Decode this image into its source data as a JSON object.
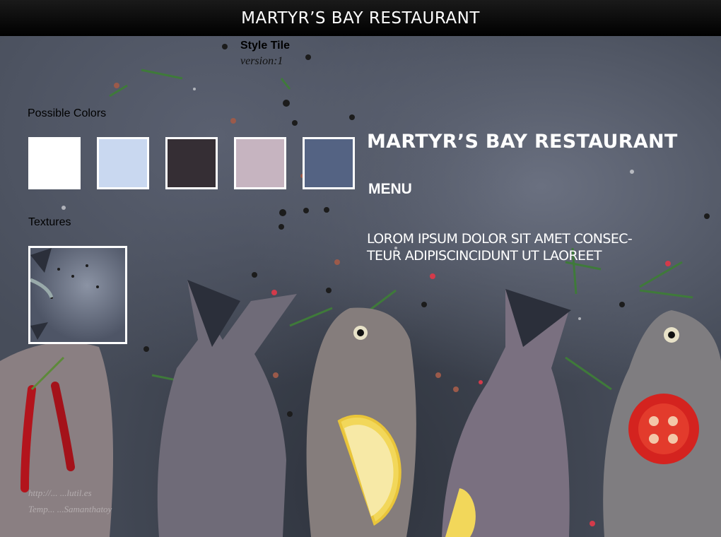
{
  "header": {
    "title": "MARTYR’S BAY RESTAURANT"
  },
  "style_tile": {
    "title": "Style Tile",
    "version": "version:1"
  },
  "colors_section": {
    "label": "Possible Colors",
    "swatches": [
      "#FFFFFF",
      "#C9D8F0",
      "#352E34",
      "#C6B4C0",
      "#546383"
    ]
  },
  "textures_section": {
    "label": "Textures"
  },
  "content": {
    "title": "MARTYR’S BAY RESTAURANT",
    "menu": "MENU",
    "body_line1": "LOROM IPSUM DOLOR SIT AMET CONSEC-",
    "body_line2": "TEUR ADIPISCINCIDUNT UT LAOREET"
  },
  "credits": {
    "line1": "http://... ...lutil.es",
    "line2": "Temp... ...Samanthatoy"
  },
  "icons": [
    "fish-photo",
    "lemon-slice",
    "tomato-slice",
    "chili-pepper",
    "rosemary-sprig"
  ]
}
